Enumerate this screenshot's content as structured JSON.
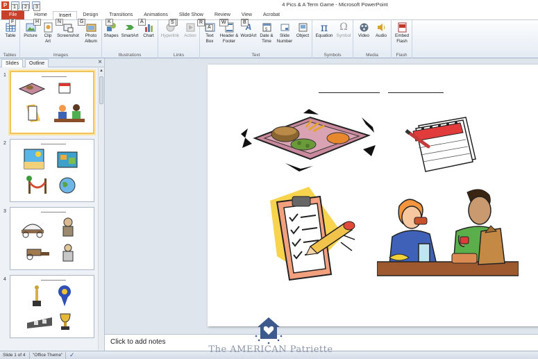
{
  "window": {
    "title": "4 Pics & A Term Game  -  Microsoft PowerPoint"
  },
  "qat": {
    "logo_letter": "P",
    "keytips": [
      "1",
      "2",
      "3"
    ]
  },
  "tabs": [
    {
      "label": "File",
      "keytip": "F"
    },
    {
      "label": "Home",
      "keytip": "H"
    },
    {
      "label": "Insert",
      "keytip": "N"
    },
    {
      "label": "Design",
      "keytip": "G"
    },
    {
      "label": "Transitions",
      "keytip": "K"
    },
    {
      "label": "Animations",
      "keytip": "A"
    },
    {
      "label": "Slide Show",
      "keytip": "S"
    },
    {
      "label": "Review",
      "keytip": "R"
    },
    {
      "label": "View",
      "keytip": "W"
    },
    {
      "label": "Acrobat",
      "keytip": "B"
    }
  ],
  "ribbon": {
    "groups": {
      "tables": "Tables",
      "images": "Images",
      "illustrations": "Illustrations",
      "links": "Links",
      "text": "Text",
      "symbols": "Symbols",
      "media": "Media",
      "flash": "Flash"
    },
    "buttons": {
      "table": "Table",
      "picture": "Picture",
      "clip_art": "Clip Art",
      "screenshot": "Screenshot",
      "photo_album": "Photo Album",
      "shapes": "Shapes",
      "smartart": "SmartArt",
      "chart": "Chart",
      "hyperlink": "Hyperlink",
      "action": "Action",
      "text_box": "Text Box",
      "header_footer": "Header & Footer",
      "wordart": "WordArt",
      "date_time": "Date & Time",
      "slide_number": "Slide Number",
      "object": "Object",
      "equation": "Equation",
      "symbol": "Symbol",
      "video": "Video",
      "audio": "Audio",
      "embed_flash": "Embed Flash"
    },
    "icons": {
      "equation": "π",
      "symbol": "Ω",
      "wordart": "A",
      "slide_number": "#"
    }
  },
  "slides_pane": {
    "tabs": [
      "Slides",
      "Outline"
    ],
    "close": "×",
    "thumbnails": [
      {
        "number": "1",
        "selected": true
      },
      {
        "number": "2",
        "selected": false
      },
      {
        "number": "3",
        "selected": false
      },
      {
        "number": "4",
        "selected": false
      }
    ]
  },
  "notes": {
    "placeholder": "Click to add notes"
  },
  "status": {
    "slide_info": "Slide 1 of 4",
    "theme": "\"Office Theme\""
  },
  "watermark": {
    "text": "The AMERICAN Patriette"
  },
  "colors": {
    "file_tab": "#c8402a",
    "ribbon_bg": "#e4ebf4",
    "selected_thumbnail": "#f2c45c",
    "workspace_bg": "#dfe5ec"
  }
}
